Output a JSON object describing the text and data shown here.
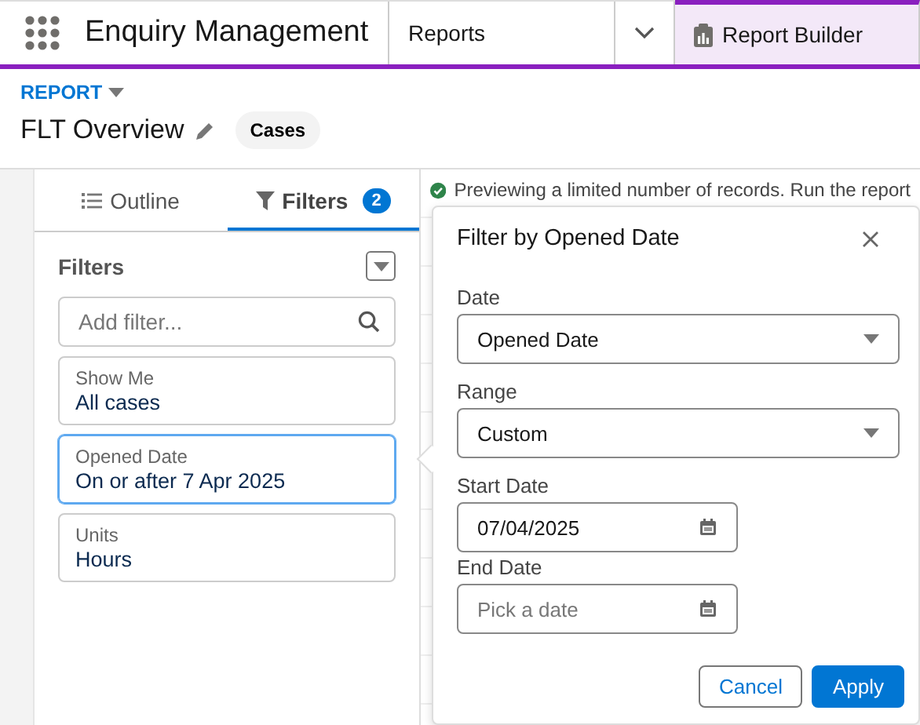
{
  "app": {
    "title": "Enquiry Management"
  },
  "nav_tabs": [
    {
      "kind": "text",
      "label": "Reports",
      "selected": false
    },
    {
      "kind": "menu",
      "selected": false
    },
    {
      "kind": "builder",
      "label": "Report Builder",
      "selected": true
    }
  ],
  "header": {
    "eyebrow": "REPORT",
    "title": "FLT Overview",
    "object_badge": "Cases"
  },
  "panel_tabs": [
    {
      "kind": "outline",
      "label": "Outline",
      "selected": false
    },
    {
      "kind": "filters",
      "label": "Filters",
      "count": "2",
      "selected": true
    }
  ],
  "filters_panel": {
    "heading": "Filters",
    "search": {
      "placeholder": "Add filter..."
    },
    "filters": [
      {
        "label": "Show Me",
        "value": "All cases",
        "selected": false
      },
      {
        "label": "Opened Date",
        "value": "On or after 7 Apr 2025",
        "selected": true
      },
      {
        "label": "Units",
        "value": "Hours",
        "selected": false
      }
    ]
  },
  "preview_notice": "Previewing a limited number of records. Run the report",
  "popover": {
    "title": "Filter by Opened Date",
    "fields": [
      {
        "kind": "select",
        "label": "Date",
        "value": "Opened Date"
      },
      {
        "kind": "select",
        "label": "Range",
        "value": "Custom"
      },
      {
        "kind": "date",
        "label": "Start Date",
        "value": "07/04/2025"
      },
      {
        "kind": "date",
        "label": "End Date",
        "placeholder": "Pick a date"
      }
    ],
    "buttons": [
      {
        "kind": "neutral",
        "label": "Cancel"
      },
      {
        "kind": "brand",
        "label": "Apply"
      }
    ]
  }
}
